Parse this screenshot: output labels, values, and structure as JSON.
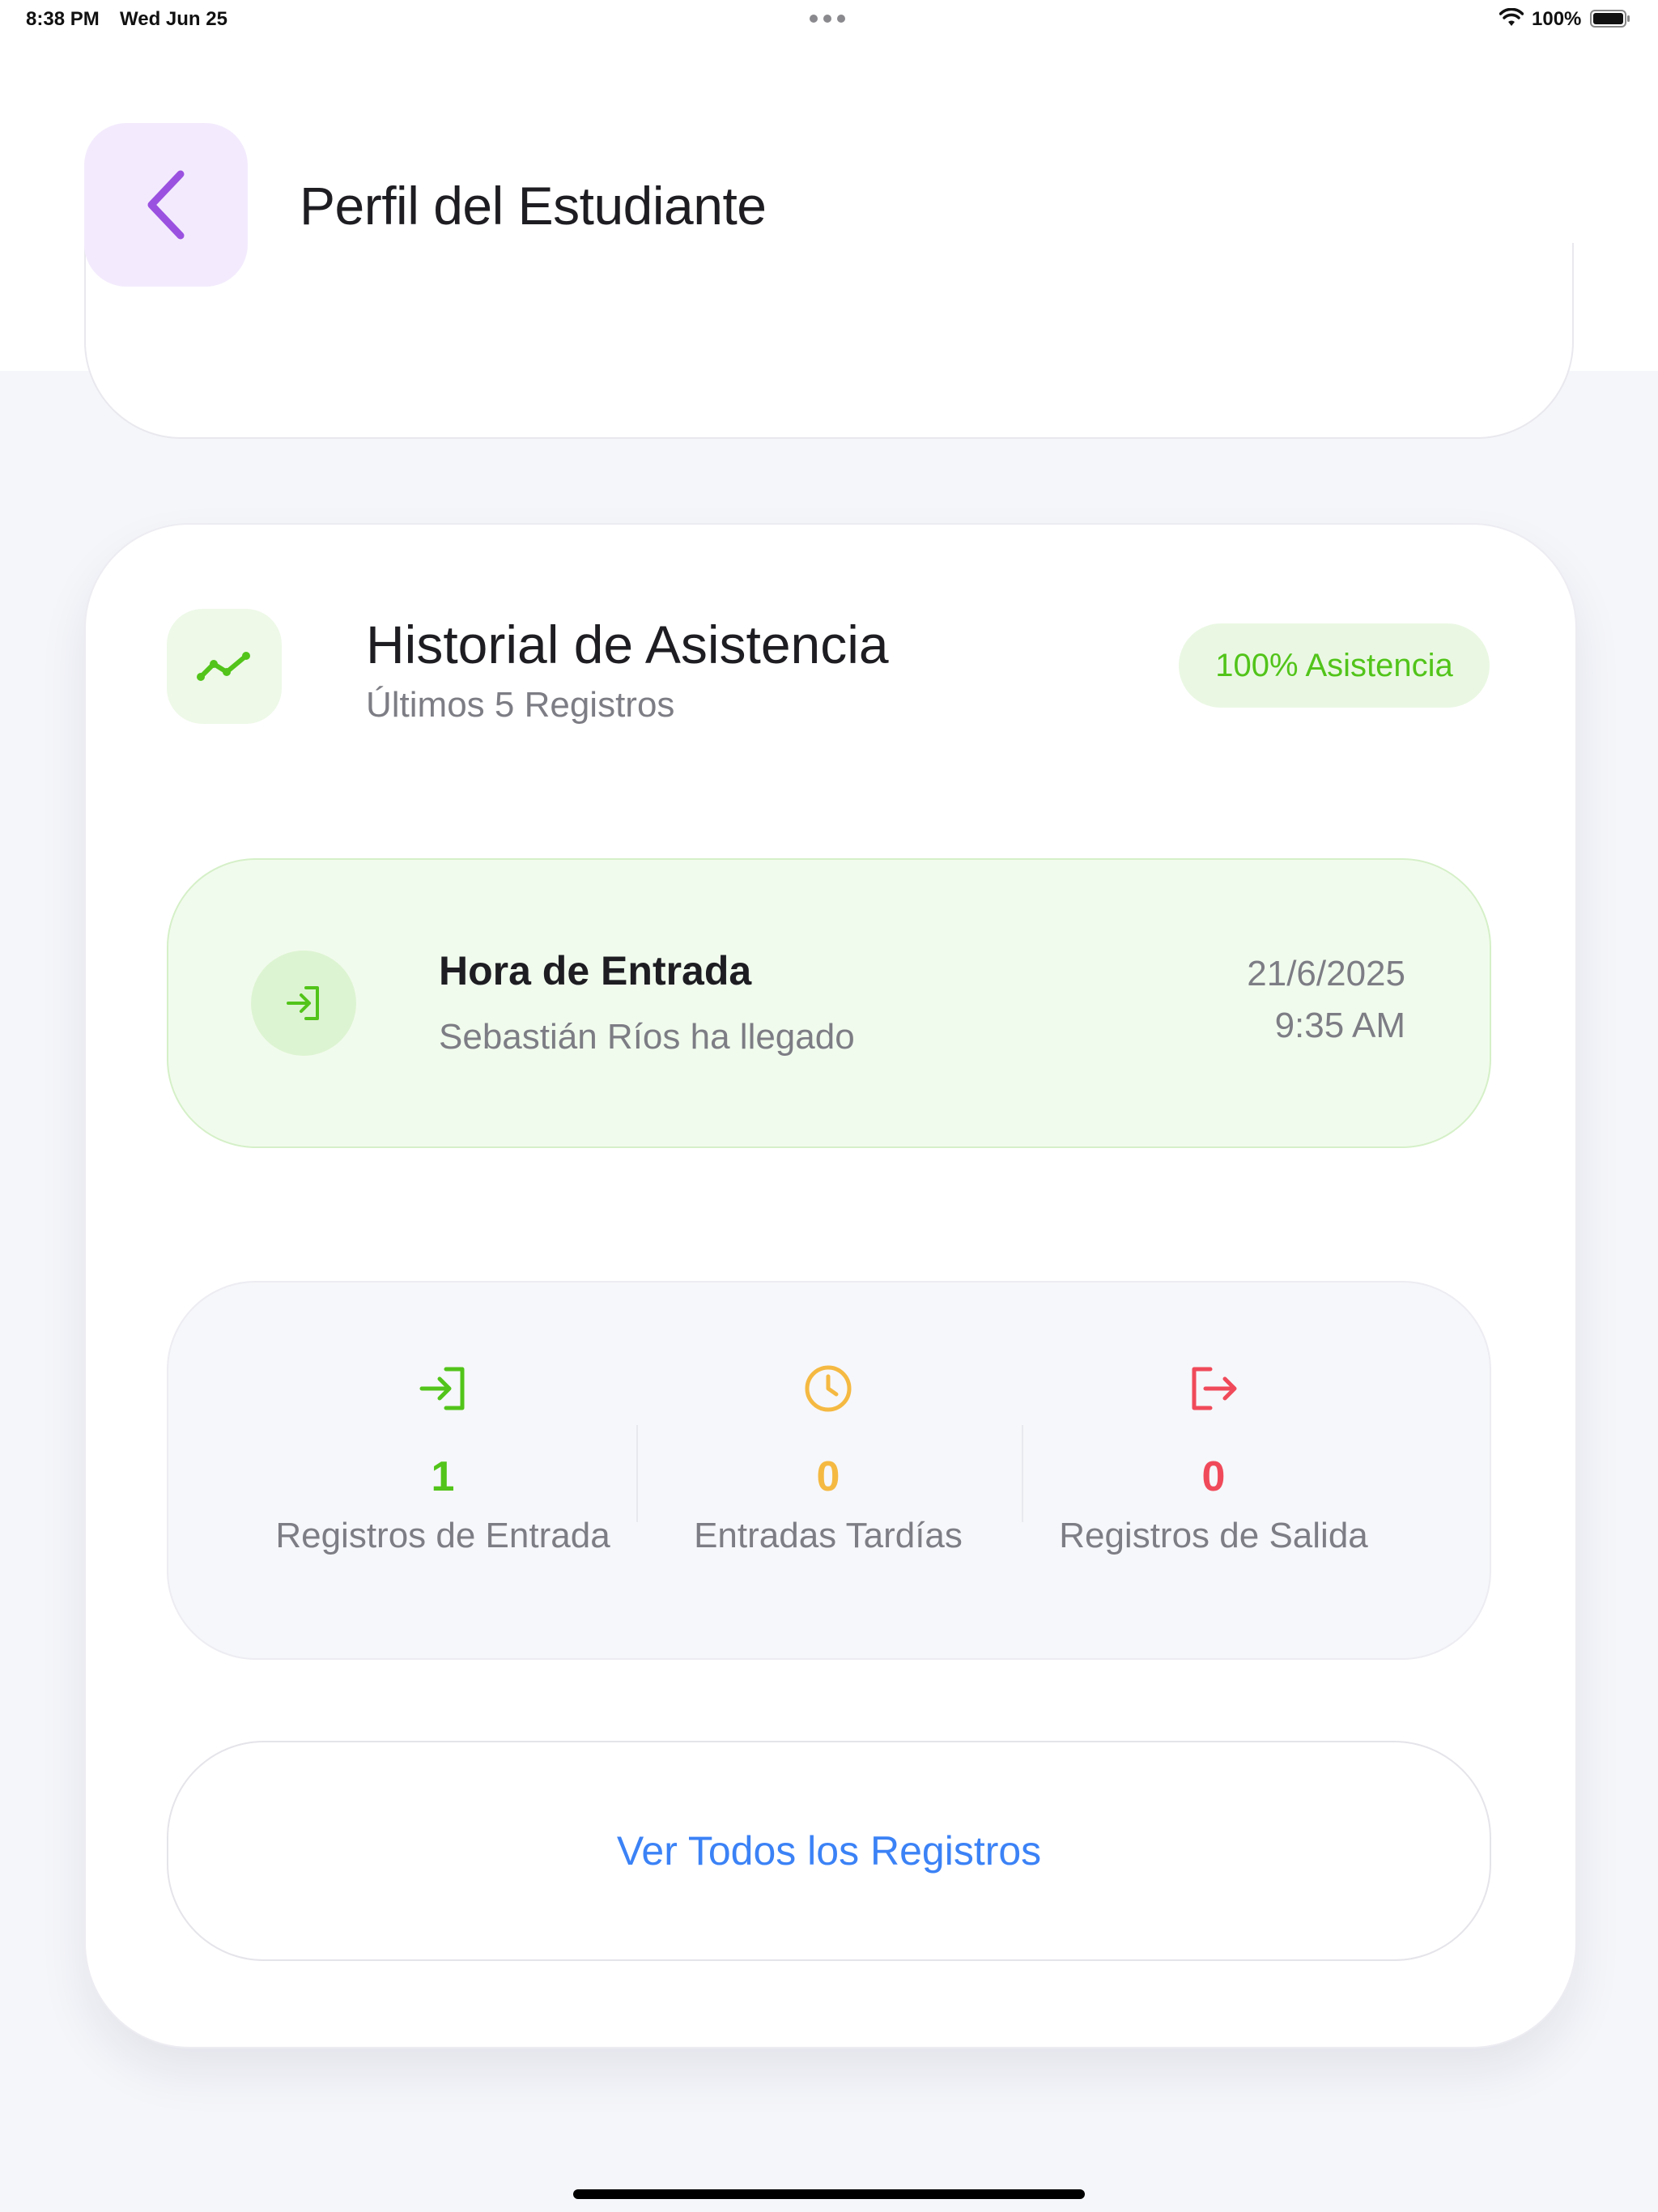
{
  "status_bar": {
    "time": "8:38 PM",
    "date": "Wed Jun 25",
    "battery": "100%"
  },
  "header": {
    "title": "Perfil del Estudiante"
  },
  "history": {
    "title": "Historial de Asistencia",
    "subtitle": "Últimos 5 Registros",
    "badge": "100% Asistencia"
  },
  "entry": {
    "title": "Hora de Entrada",
    "description": "Sebastián Ríos ha llegado",
    "date": "21/6/2025",
    "time": "9:35 AM"
  },
  "stats": [
    {
      "value": "1",
      "label": "Registros de Entrada",
      "color": "#52c41a"
    },
    {
      "value": "0",
      "label": "Entradas Tardías",
      "color": "#f5b942"
    },
    {
      "value": "0",
      "label": "Registros de Salida",
      "color": "#f04a5a"
    }
  ],
  "view_all_button": "Ver Todos los Registros",
  "colors": {
    "accent_purple": "#9b51e0",
    "green": "#52c41a",
    "blue": "#3b82f6"
  }
}
